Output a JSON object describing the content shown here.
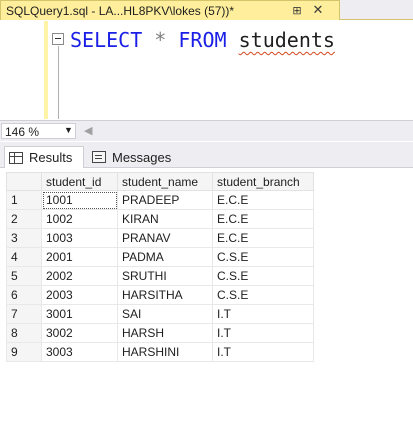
{
  "document_tab": {
    "title": "SQLQuery1.sql - LA...HL8PKV\\lokes (57))*",
    "pin_icon": "pin-icon",
    "close_icon": "close-icon"
  },
  "editor": {
    "keyword_select": "SELECT",
    "operator": "*",
    "keyword_from": "FROM",
    "table_name": "students",
    "colors": {
      "keyword": "#1a1ee6",
      "operator": "#808080",
      "squiggle": "#d4481e"
    }
  },
  "zoom": {
    "value": "146 %"
  },
  "result_tabs": [
    {
      "label": "Results",
      "icon": "grid-icon"
    },
    {
      "label": "Messages",
      "icon": "messages-icon"
    }
  ],
  "grid": {
    "columns": [
      "student_id",
      "student_name",
      "student_branch"
    ],
    "rows": [
      {
        "num": "1",
        "student_id": "1001",
        "student_name": "PRADEEP",
        "student_branch": "E.C.E"
      },
      {
        "num": "2",
        "student_id": "1002",
        "student_name": "KIRAN",
        "student_branch": "E.C.E"
      },
      {
        "num": "3",
        "student_id": "1003",
        "student_name": "PRANAV",
        "student_branch": "E.C.E"
      },
      {
        "num": "4",
        "student_id": "2001",
        "student_name": "PADMA",
        "student_branch": "C.S.E"
      },
      {
        "num": "5",
        "student_id": "2002",
        "student_name": "SRUTHI",
        "student_branch": "C.S.E"
      },
      {
        "num": "6",
        "student_id": "2003",
        "student_name": "HARSITHA",
        "student_branch": "C.S.E"
      },
      {
        "num": "7",
        "student_id": "3001",
        "student_name": "SAI",
        "student_branch": "I.T"
      },
      {
        "num": "8",
        "student_id": "3002",
        "student_name": "HARSH",
        "student_branch": "I.T"
      },
      {
        "num": "9",
        "student_id": "3003",
        "student_name": "HARSHINI",
        "student_branch": "I.T"
      }
    ]
  }
}
